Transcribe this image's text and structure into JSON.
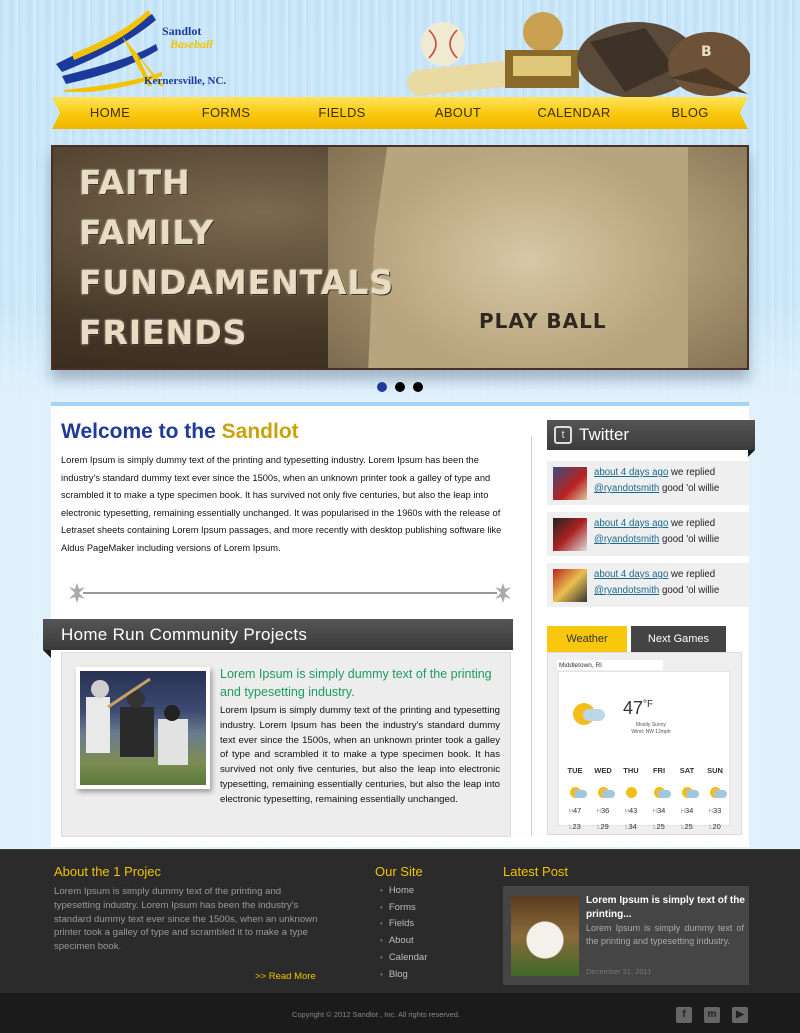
{
  "header": {
    "logo_line1": "Sandlot",
    "logo_line2": "Baseball",
    "logo_location": "Kernersville, NC.",
    "nav": [
      "HOME",
      "FORMS",
      "FIELDS",
      "ABOUT",
      "CALENDAR",
      "BLOG"
    ]
  },
  "hero": {
    "words": [
      "FAITH",
      "FAMILY",
      "FUNDAMENTALS",
      "FRIENDS"
    ],
    "play_ball": "PLAY BALL",
    "slides_total": 3,
    "slide_active": 1
  },
  "welcome": {
    "title_prefix": "Welcome to the ",
    "title_highlight": "Sandlot",
    "text": "Lorem Ipsum is simply dummy text of the printing and typesetting industry. Lorem Ipsum has been the industry's standard dummy text ever since the 1500s, when an unknown printer took a galley of type and scrambled it to make a type specimen book. It has survived not only five centuries, but also the leap into electronic typesetting, remaining essentially unchanged. It was popularised in the 1960s with the release of Letraset sheets containing Lorem Ipsum passages, and more recently with desktop publishing software like Aldus PageMaker including versions of Lorem Ipsum."
  },
  "projects": {
    "heading": "Home Run Community Projects",
    "title": "Lorem Ipsum is simply dummy text of the printing and typesetting industry.",
    "text": "Lorem Ipsum is simply dummy text of the printing and typesetting industry. Lorem Ipsum has been the industry's standard dummy text ever since the 1500s, when an unknown printer took a galley of type and scrambled it to make a type specimen book. It has survived not only five centuries, but also the leap into electronic typesetting, remaining essentially centuries, but also the leap into electronic typesetting, remaining essentially unchanged."
  },
  "twitter": {
    "heading": "Twitter",
    "tweets": [
      {
        "time": "about 4 days ago",
        "action": " we replied",
        "handle": "@ryandotsmith",
        "text": " good 'ol willie"
      },
      {
        "time": "about 4 days ago",
        "action": " we replied",
        "handle": "@ryandotsmith",
        "text": " good 'ol willie"
      },
      {
        "time": "about 4 days ago",
        "action": " we replied",
        "handle": "@ryandotsmith",
        "text": " good 'ol willie"
      }
    ]
  },
  "weather": {
    "tab_active": "Weather",
    "tab_other": "Next Games",
    "location": "Middletown, RI",
    "temp": "47",
    "unit": "°F",
    "condition": "Mostly Sunny",
    "wind": "Wind: NW 12mph",
    "days": [
      {
        "name": "TUE",
        "hi": "47",
        "lo": "23",
        "cloud": true
      },
      {
        "name": "WED",
        "hi": "36",
        "lo": "29",
        "cloud": true
      },
      {
        "name": "THU",
        "hi": "43",
        "lo": "34",
        "cloud": false
      },
      {
        "name": "FRI",
        "hi": "34",
        "lo": "25",
        "cloud": true
      },
      {
        "name": "SAT",
        "hi": "34",
        "lo": "25",
        "cloud": true
      },
      {
        "name": "SUN",
        "hi": "33",
        "lo": "20",
        "cloud": true
      }
    ]
  },
  "footer": {
    "about_heading": "About the 1 Projec",
    "about_text": "Lorem Ipsum is simply dummy text of the printing and typesetting industry. Lorem Ipsum has been the industry's standard dummy text ever since the 1500s, when an unknown printer took a galley of type and scrambled it to make a type specimen book.",
    "read_more": ">> Read More",
    "site_heading": "Our Site",
    "site_links": [
      "Home",
      "Forms",
      "Fields",
      "About",
      "Calendar",
      "Blog"
    ],
    "post_heading": "Latest Post",
    "post_title": "Lorem Ipsum is simply text of the printing...",
    "post_text": "Lorem Ipsum is simply dummy text of the printing and typesetting industry.",
    "post_date": "December 31, 2011",
    "copyright": "Copyright © 2012 Sandlot , Inc. All rights reserved."
  },
  "colors": {
    "accent_yellow": "#f9c80c",
    "title_blue": "#203a9c",
    "green_title": "#1c9b62",
    "dark_panel": "#2b2b2b"
  }
}
